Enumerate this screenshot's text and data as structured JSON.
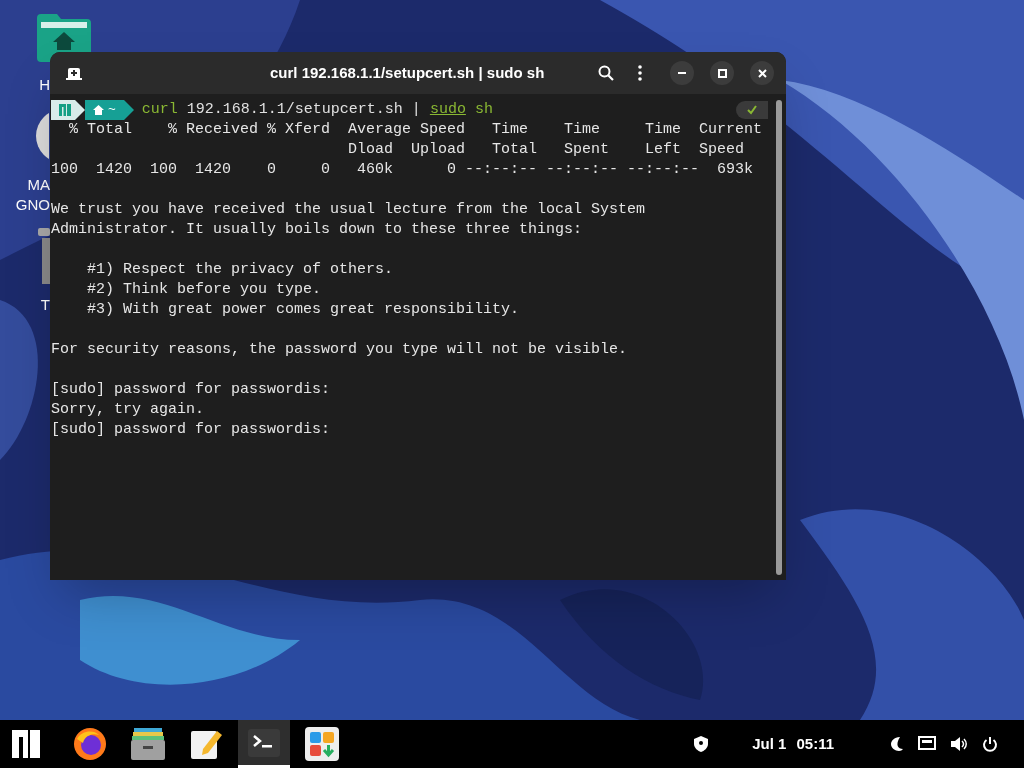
{
  "desktop_icons": [
    {
      "kind": "folder",
      "label": [
        "H"
      ]
    },
    {
      "kind": "disc",
      "label": [
        "MA",
        "GNO"
      ]
    },
    {
      "kind": "trash",
      "label": [
        "T"
      ]
    }
  ],
  "window": {
    "title": "curl 192.168.1.1/setupcert.sh | sudo sh",
    "prompt": {
      "dir": "~",
      "command": [
        {
          "kind": "program",
          "text": "curl"
        },
        {
          "kind": "arg",
          "text": " 192.168.1.1/setupcert.sh | "
        },
        {
          "kind": "sudo",
          "text": "sudo"
        },
        {
          "kind": "program",
          "text": " sh"
        }
      ],
      "status_ok": true
    },
    "output": [
      [
        "  % Total    % Received % Xferd  Average Speed   Time    Time     Time  Current",
        "                                 Dload  Upload   Total   Spent    Left  Speed",
        "100  1420  100  1420    0     0   460k      0 --:--:-- --:--:-- --:--:--  693k"
      ],
      [
        "We trust you have received the usual lecture from the local System",
        "Administrator. It usually boils down to these three things:"
      ],
      [
        "    #1) Respect the privacy of others.",
        "    #2) Think before you type.",
        "    #3) With great power comes great responsibility."
      ],
      [
        "For security reasons, the password you type will not be visible."
      ],
      [
        "[sudo] password for passwordis:",
        "Sorry, try again.",
        "[sudo] password for passwordis:"
      ]
    ]
  },
  "taskbar": {
    "apps": [
      {
        "kind": "firefox",
        "selected": false
      },
      {
        "kind": "files",
        "selected": false
      },
      {
        "kind": "editor",
        "selected": false
      },
      {
        "kind": "terminal",
        "selected": true
      },
      {
        "kind": "software",
        "selected": false
      }
    ],
    "date": "Jul 1",
    "time": "05:11"
  }
}
